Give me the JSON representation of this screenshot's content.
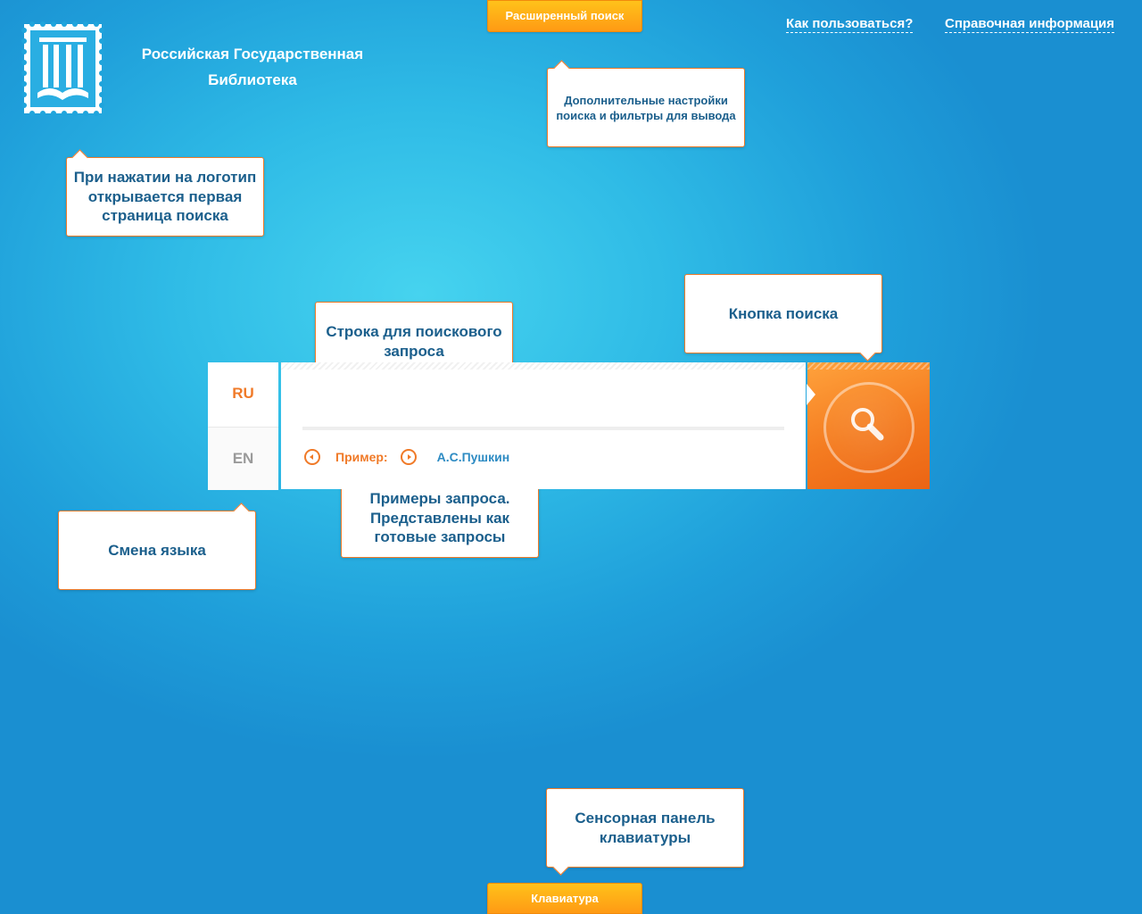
{
  "header": {
    "library_name_line1": "Российская Государственная",
    "library_name_line2": "Библиотека",
    "advanced_search": "Расширенный поиск",
    "how_to_use": "Как пользоваться?",
    "reference_info": "Справочная информация"
  },
  "callouts": {
    "advanced": "Дополнительные настройки поиска и фильтры для вывода",
    "logo": "При нажатии на логотип открывается первая страница поиска",
    "search_line": "Строка для поискового запроса",
    "search_button": "Кнопка поиска",
    "examples": "Примеры запроса. Представлены как готовые запросы",
    "language": "Смена языка",
    "keyboard": "Сенсорная панель клавиатуры"
  },
  "search": {
    "lang_ru": "RU",
    "lang_en": "EN",
    "query_value": "",
    "example_label": "Пример:",
    "example_value": "А.С.Пушкин"
  },
  "footer": {
    "keyboard_tab": "Клавиатура"
  },
  "colors": {
    "accent_orange": "#f07a28",
    "text_blue": "#1b5f8c",
    "background_blue": "#2fbbe6"
  },
  "icons": {
    "logo": "library-stamp-logo",
    "search": "magnifier-icon",
    "prev": "arrow-left-circle-icon",
    "next": "arrow-right-circle-icon"
  }
}
